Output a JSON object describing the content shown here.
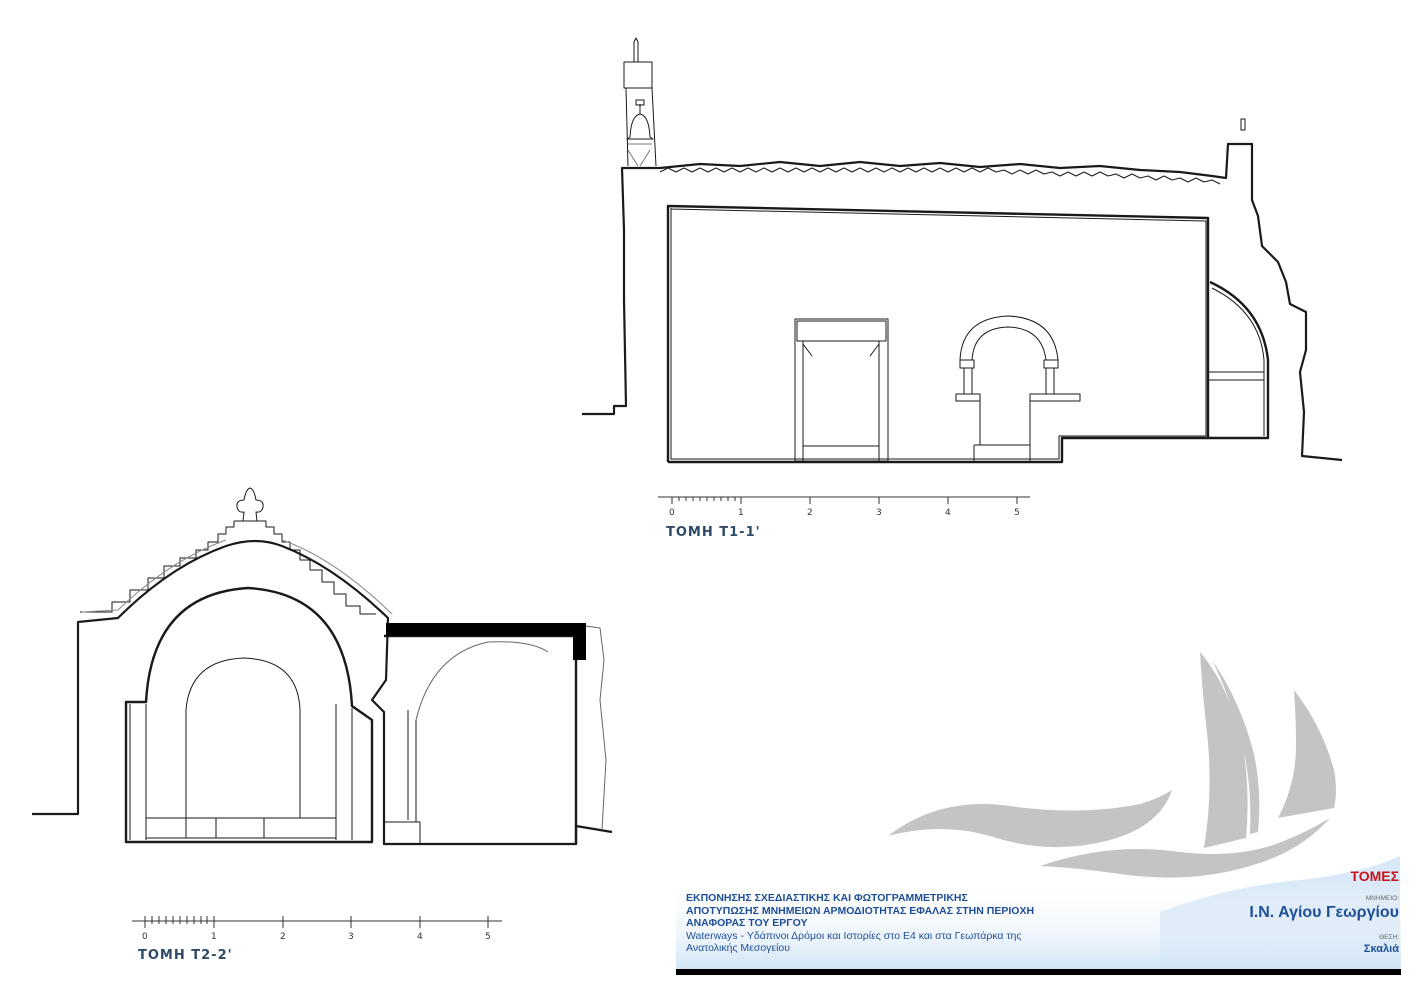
{
  "sections": [
    {
      "label": "ΤΟΜΗ Τ1-1'",
      "scale_ticks": [
        "0",
        "1",
        "2",
        "3",
        "4",
        "5"
      ]
    },
    {
      "label": "ΤΟΜΗ Τ2-2'",
      "scale_ticks": [
        "0",
        "1",
        "2",
        "3",
        "4",
        "5"
      ]
    }
  ],
  "title_block": {
    "project_lines": [
      "ΕΚΠΟΝΗΣΗΣ ΣΧΕΔΙΑΣΤΙΚΗΣ ΚΑΙ ΦΩΤΟΓΡΑΜΜΕΤΡΙΚΗΣ",
      "ΑΠΟΤΥΠΩΣΗΣ ΜΝΗΜΕΙΩΝ ΑΡΜΟΔΙΟΤΗΤΑΣ ΕΦΑΛΑΣ ΣΤΗΝ ΠΕΡΙΟΧΗ",
      "ΑΝΑΦΟΡΑΣ ΤΟΥ ΕΡΓΟΥ",
      "Waterways -  Υδάπινοι Δρόμοι και Ιστορίες στο Ε4 και στα Γεωπάρκα της",
      "Ανατολικής Μεσογείου"
    ],
    "drawing_title": "ΤΟΜΕΣ",
    "monument_caption": "ΜΝΗΜΕΙΟ:",
    "monument_name": "Ι.Ν. Αγίου Γεωργίου",
    "location_caption": "ΘΕΣΗ:",
    "location_name": "Σκαλιά"
  },
  "colors": {
    "line": "#1a1a1a",
    "fill_black": "#000000",
    "text_blue": "#1e4f96",
    "text_red": "#c8141e",
    "logo_grey": "#c4c4c4",
    "logo_blue_light": "#d9e9f7"
  }
}
